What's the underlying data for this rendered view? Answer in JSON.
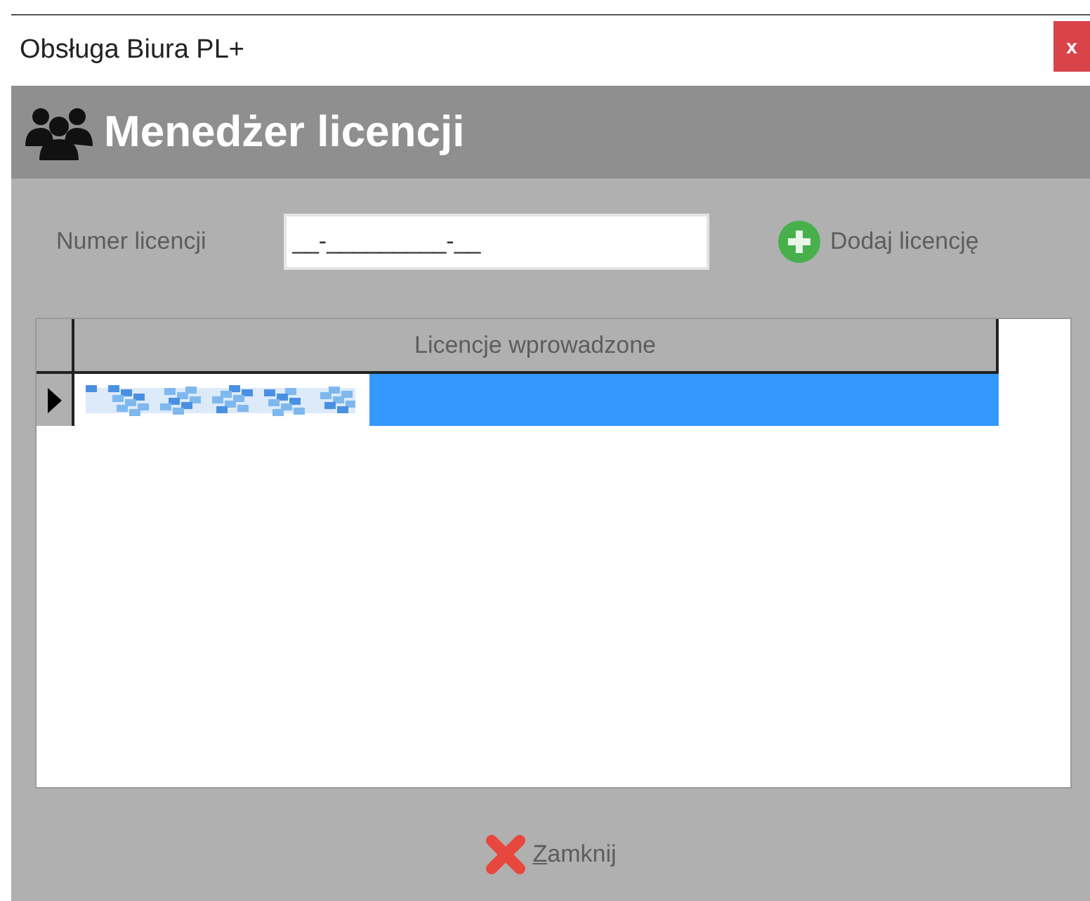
{
  "window": {
    "title": "Obsługa Biura PL+",
    "close": "x"
  },
  "header": {
    "title": "Menedżer licencji"
  },
  "license_field": {
    "label": "Numer licencji",
    "value": "__-_________-__"
  },
  "add_button": {
    "label": "Dodaj licencję"
  },
  "table": {
    "columns": [
      "Licencje wprowadzone"
    ],
    "rows": [
      {
        "selected": true,
        "current": true
      }
    ]
  },
  "close_button": {
    "label": "Zamknij"
  }
}
